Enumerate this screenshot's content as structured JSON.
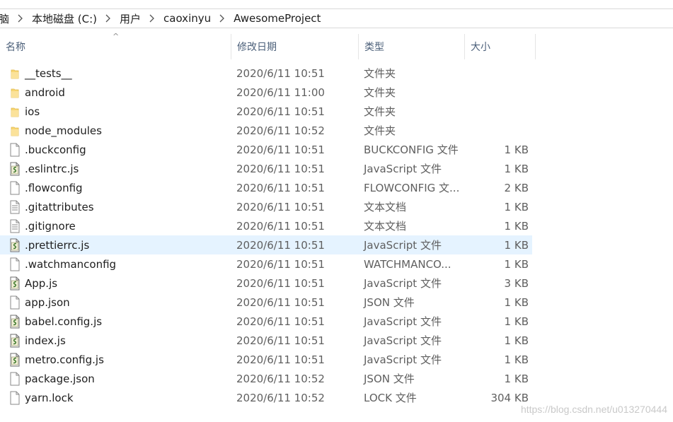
{
  "breadcrumb": {
    "items": [
      "脑",
      "本地磁盘 (C:)",
      "用户",
      "caoxinyu",
      "AwesomeProject"
    ]
  },
  "columns": {
    "name": "名称",
    "date": "修改日期",
    "type": "类型",
    "size": "大小"
  },
  "files": [
    {
      "name": "__tests__",
      "date": "2020/6/11 10:51",
      "type": "文件夹",
      "size": "",
      "icon": "folder-icon"
    },
    {
      "name": "android",
      "date": "2020/6/11 11:00",
      "type": "文件夹",
      "size": "",
      "icon": "folder-icon"
    },
    {
      "name": "ios",
      "date": "2020/6/11 10:51",
      "type": "文件夹",
      "size": "",
      "icon": "folder-icon"
    },
    {
      "name": "node_modules",
      "date": "2020/6/11 10:52",
      "type": "文件夹",
      "size": "",
      "icon": "folder-icon"
    },
    {
      "name": ".buckconfig",
      "date": "2020/6/11 10:51",
      "type": "BUCKCONFIG 文件",
      "size": "1 KB",
      "icon": "blank-file-icon"
    },
    {
      "name": ".eslintrc.js",
      "date": "2020/6/11 10:51",
      "type": "JavaScript 文件",
      "size": "1 KB",
      "icon": "js-file-icon"
    },
    {
      "name": ".flowconfig",
      "date": "2020/6/11 10:51",
      "type": "FLOWCONFIG 文...",
      "size": "2 KB",
      "icon": "blank-file-icon"
    },
    {
      "name": ".gitattributes",
      "date": "2020/6/11 10:51",
      "type": "文本文档",
      "size": "1 KB",
      "icon": "text-file-icon"
    },
    {
      "name": ".gitignore",
      "date": "2020/6/11 10:51",
      "type": "文本文档",
      "size": "1 KB",
      "icon": "text-file-icon"
    },
    {
      "name": ".prettierrc.js",
      "date": "2020/6/11 10:51",
      "type": "JavaScript 文件",
      "size": "1 KB",
      "icon": "js-file-icon",
      "selected": true
    },
    {
      "name": ".watchmanconfig",
      "date": "2020/6/11 10:51",
      "type": "WATCHMANCO...",
      "size": "1 KB",
      "icon": "blank-file-icon"
    },
    {
      "name": "App.js",
      "date": "2020/6/11 10:51",
      "type": "JavaScript 文件",
      "size": "3 KB",
      "icon": "js-file-icon"
    },
    {
      "name": "app.json",
      "date": "2020/6/11 10:51",
      "type": "JSON 文件",
      "size": "1 KB",
      "icon": "blank-file-icon"
    },
    {
      "name": "babel.config.js",
      "date": "2020/6/11 10:51",
      "type": "JavaScript 文件",
      "size": "1 KB",
      "icon": "js-file-icon"
    },
    {
      "name": "index.js",
      "date": "2020/6/11 10:51",
      "type": "JavaScript 文件",
      "size": "1 KB",
      "icon": "js-file-icon"
    },
    {
      "name": "metro.config.js",
      "date": "2020/6/11 10:51",
      "type": "JavaScript 文件",
      "size": "1 KB",
      "icon": "js-file-icon"
    },
    {
      "name": "package.json",
      "date": "2020/6/11 10:52",
      "type": "JSON 文件",
      "size": "1 KB",
      "icon": "blank-file-icon"
    },
    {
      "name": "yarn.lock",
      "date": "2020/6/11 10:52",
      "type": "LOCK 文件",
      "size": "304 KB",
      "icon": "blank-file-icon"
    }
  ],
  "watermark": "https://blog.csdn.net/u013270444",
  "colors": {
    "selected_row": "#e5f3ff",
    "folder": "#f8d775",
    "header_text": "#4c607a"
  }
}
